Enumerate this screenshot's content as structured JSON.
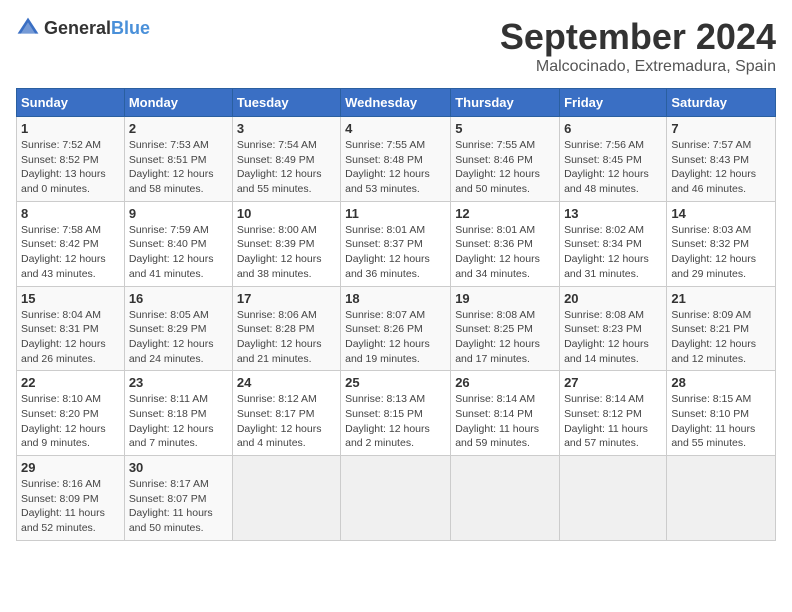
{
  "header": {
    "logo_general": "General",
    "logo_blue": "Blue",
    "title": "September 2024",
    "subtitle": "Malcocinado, Extremadura, Spain"
  },
  "calendar": {
    "days_of_week": [
      "Sunday",
      "Monday",
      "Tuesday",
      "Wednesday",
      "Thursday",
      "Friday",
      "Saturday"
    ],
    "weeks": [
      [
        {
          "day": "",
          "info": ""
        },
        {
          "day": "2",
          "info": "Sunrise: 7:53 AM\nSunset: 8:51 PM\nDaylight: 12 hours\nand 58 minutes."
        },
        {
          "day": "3",
          "info": "Sunrise: 7:54 AM\nSunset: 8:49 PM\nDaylight: 12 hours\nand 55 minutes."
        },
        {
          "day": "4",
          "info": "Sunrise: 7:55 AM\nSunset: 8:48 PM\nDaylight: 12 hours\nand 53 minutes."
        },
        {
          "day": "5",
          "info": "Sunrise: 7:55 AM\nSunset: 8:46 PM\nDaylight: 12 hours\nand 50 minutes."
        },
        {
          "day": "6",
          "info": "Sunrise: 7:56 AM\nSunset: 8:45 PM\nDaylight: 12 hours\nand 48 minutes."
        },
        {
          "day": "7",
          "info": "Sunrise: 7:57 AM\nSunset: 8:43 PM\nDaylight: 12 hours\nand 46 minutes."
        }
      ],
      [
        {
          "day": "1",
          "info": "Sunrise: 7:52 AM\nSunset: 8:52 PM\nDaylight: 13 hours\nand 0 minutes."
        },
        {
          "day": "9",
          "info": "Sunrise: 7:59 AM\nSunset: 8:40 PM\nDaylight: 12 hours\nand 41 minutes."
        },
        {
          "day": "10",
          "info": "Sunrise: 8:00 AM\nSunset: 8:39 PM\nDaylight: 12 hours\nand 38 minutes."
        },
        {
          "day": "11",
          "info": "Sunrise: 8:01 AM\nSunset: 8:37 PM\nDaylight: 12 hours\nand 36 minutes."
        },
        {
          "day": "12",
          "info": "Sunrise: 8:01 AM\nSunset: 8:36 PM\nDaylight: 12 hours\nand 34 minutes."
        },
        {
          "day": "13",
          "info": "Sunrise: 8:02 AM\nSunset: 8:34 PM\nDaylight: 12 hours\nand 31 minutes."
        },
        {
          "day": "14",
          "info": "Sunrise: 8:03 AM\nSunset: 8:32 PM\nDaylight: 12 hours\nand 29 minutes."
        }
      ],
      [
        {
          "day": "8",
          "info": "Sunrise: 7:58 AM\nSunset: 8:42 PM\nDaylight: 12 hours\nand 43 minutes."
        },
        {
          "day": "16",
          "info": "Sunrise: 8:05 AM\nSunset: 8:29 PM\nDaylight: 12 hours\nand 24 minutes."
        },
        {
          "day": "17",
          "info": "Sunrise: 8:06 AM\nSunset: 8:28 PM\nDaylight: 12 hours\nand 21 minutes."
        },
        {
          "day": "18",
          "info": "Sunrise: 8:07 AM\nSunset: 8:26 PM\nDaylight: 12 hours\nand 19 minutes."
        },
        {
          "day": "19",
          "info": "Sunrise: 8:08 AM\nSunset: 8:25 PM\nDaylight: 12 hours\nand 17 minutes."
        },
        {
          "day": "20",
          "info": "Sunrise: 8:08 AM\nSunset: 8:23 PM\nDaylight: 12 hours\nand 14 minutes."
        },
        {
          "day": "21",
          "info": "Sunrise: 8:09 AM\nSunset: 8:21 PM\nDaylight: 12 hours\nand 12 minutes."
        }
      ],
      [
        {
          "day": "15",
          "info": "Sunrise: 8:04 AM\nSunset: 8:31 PM\nDaylight: 12 hours\nand 26 minutes."
        },
        {
          "day": "23",
          "info": "Sunrise: 8:11 AM\nSunset: 8:18 PM\nDaylight: 12 hours\nand 7 minutes."
        },
        {
          "day": "24",
          "info": "Sunrise: 8:12 AM\nSunset: 8:17 PM\nDaylight: 12 hours\nand 4 minutes."
        },
        {
          "day": "25",
          "info": "Sunrise: 8:13 AM\nSunset: 8:15 PM\nDaylight: 12 hours\nand 2 minutes."
        },
        {
          "day": "26",
          "info": "Sunrise: 8:14 AM\nSunset: 8:14 PM\nDaylight: 11 hours\nand 59 minutes."
        },
        {
          "day": "27",
          "info": "Sunrise: 8:14 AM\nSunset: 8:12 PM\nDaylight: 11 hours\nand 57 minutes."
        },
        {
          "day": "28",
          "info": "Sunrise: 8:15 AM\nSunset: 8:10 PM\nDaylight: 11 hours\nand 55 minutes."
        }
      ],
      [
        {
          "day": "22",
          "info": "Sunrise: 8:10 AM\nSunset: 8:20 PM\nDaylight: 12 hours\nand 9 minutes."
        },
        {
          "day": "30",
          "info": "Sunrise: 8:17 AM\nSunset: 8:07 PM\nDaylight: 11 hours\nand 50 minutes."
        },
        {
          "day": "",
          "info": ""
        },
        {
          "day": "",
          "info": ""
        },
        {
          "day": "",
          "info": ""
        },
        {
          "day": "",
          "info": ""
        },
        {
          "day": "",
          "info": ""
        }
      ],
      [
        {
          "day": "29",
          "info": "Sunrise: 8:16 AM\nSunset: 8:09 PM\nDaylight: 11 hours\nand 52 minutes."
        },
        {
          "day": "",
          "info": ""
        },
        {
          "day": "",
          "info": ""
        },
        {
          "day": "",
          "info": ""
        },
        {
          "day": "",
          "info": ""
        },
        {
          "day": "",
          "info": ""
        },
        {
          "day": "",
          "info": ""
        }
      ]
    ]
  }
}
